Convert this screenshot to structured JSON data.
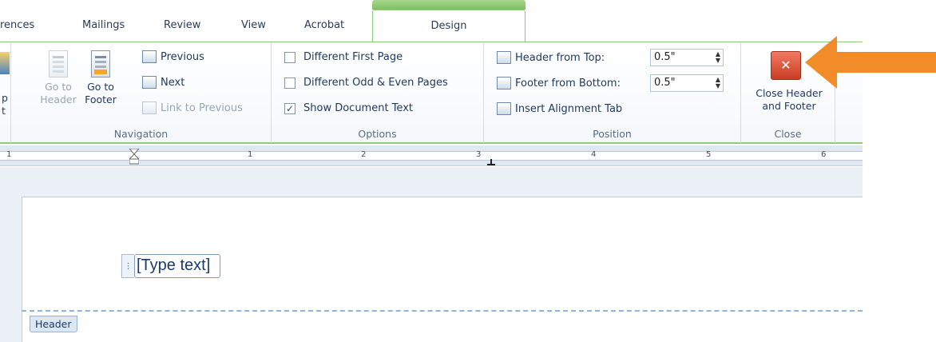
{
  "tabs": [
    "rences",
    "Mailings",
    "Review",
    "View",
    "Acrobat",
    "Design"
  ],
  "ribbon": {
    "partial_left": [
      "p",
      "t"
    ],
    "navigation": {
      "go_to_header": [
        "Go to",
        "Header"
      ],
      "go_to_footer": [
        "Go to",
        "Footer"
      ],
      "previous": "Previous",
      "next": "Next",
      "link_to_previous": "Link to Previous",
      "label": "Navigation"
    },
    "options": {
      "different_first_page": "Different First Page",
      "different_odd_even": "Different Odd & Even Pages",
      "show_document_text": "Show Document Text",
      "show_document_text_checked": "✓",
      "label": "Options"
    },
    "position": {
      "header_from_top_label": "Header from Top:",
      "header_from_top_value": "0.5\"",
      "footer_from_bottom_label": "Footer from Bottom:",
      "footer_from_bottom_value": "0.5\"",
      "insert_alignment_tab": "Insert Alignment Tab",
      "label": "Position"
    },
    "close": {
      "button_glyph": "✕",
      "button_label": [
        "Close Header",
        "and Footer"
      ],
      "label": "Close"
    }
  },
  "ruler": {
    "numbers": [
      "1",
      "1",
      "2",
      "3",
      "4",
      "5",
      "6"
    ]
  },
  "document": {
    "type_text_handle": "⋮",
    "type_text": "[Type text]",
    "header_tag": "Header"
  },
  "colors": {
    "accent_green": "#8fcc7a",
    "arrow_orange": "#f28c28",
    "close_red": "#c83d22"
  }
}
